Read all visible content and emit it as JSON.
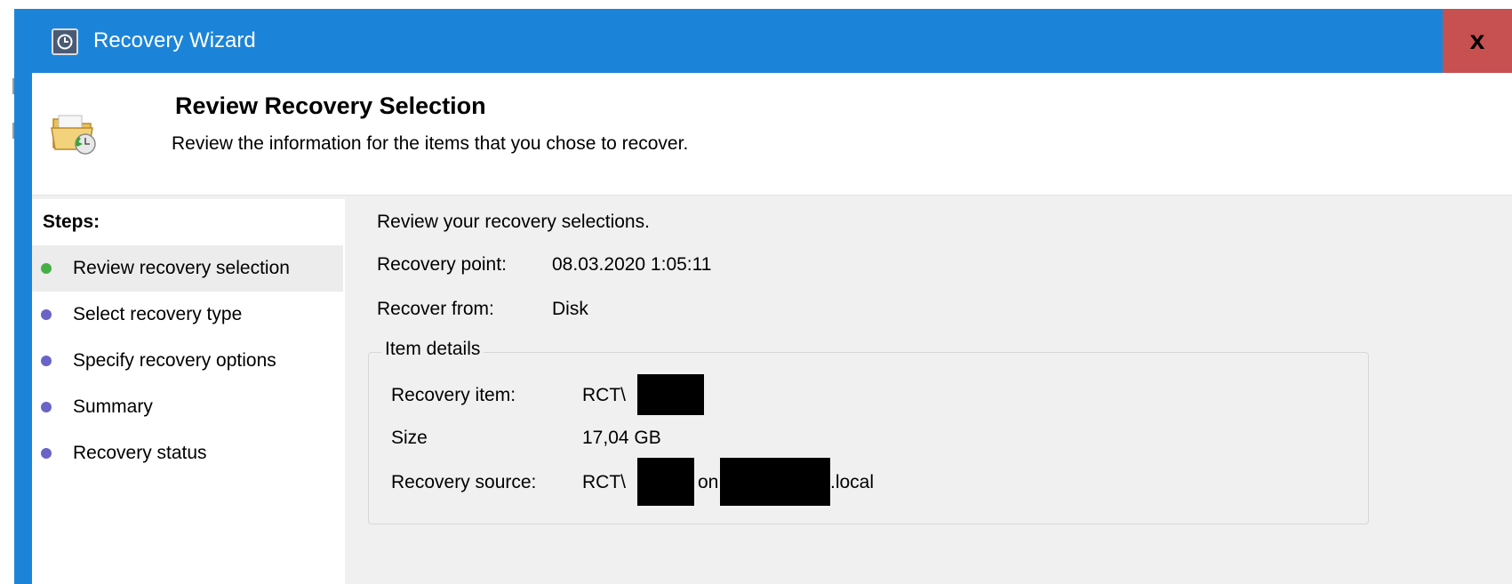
{
  "window": {
    "title": "Recovery Wizard",
    "close_label": "x"
  },
  "header": {
    "title": "Review Recovery Selection",
    "description": "Review the information for the items that you chose to recover."
  },
  "steps": {
    "heading": "Steps:",
    "items": [
      {
        "label": "Review recovery selection",
        "state": "current",
        "dot_color": "#45b045"
      },
      {
        "label": "Select recovery type",
        "state": "pending",
        "dot_color": "#6a63c8"
      },
      {
        "label": "Specify recovery options",
        "state": "pending",
        "dot_color": "#6a63c8"
      },
      {
        "label": "Summary",
        "state": "pending",
        "dot_color": "#6a63c8"
      },
      {
        "label": "Recovery status",
        "state": "pending",
        "dot_color": "#6a63c8"
      }
    ]
  },
  "main": {
    "intro": "Review your recovery selections.",
    "recovery_point_label": "Recovery point:",
    "recovery_point_value": "08.03.2020 1:05:11",
    "recover_from_label": "Recover from:",
    "recover_from_value": "Disk",
    "item_details": {
      "legend": "Item details",
      "recovery_item_label": "Recovery item:",
      "recovery_item_prefix": "RCT\\",
      "size_label": "Size",
      "size_value": "17,04 GB",
      "recovery_source_label": "Recovery source:",
      "recovery_source_prefix": "RCT\\",
      "recovery_source_on": "on",
      "recovery_source_suffix": ".local"
    }
  },
  "colors": {
    "titlebar": "#1c84d8",
    "close": "#c75050",
    "panel": "#f0f0f0"
  }
}
